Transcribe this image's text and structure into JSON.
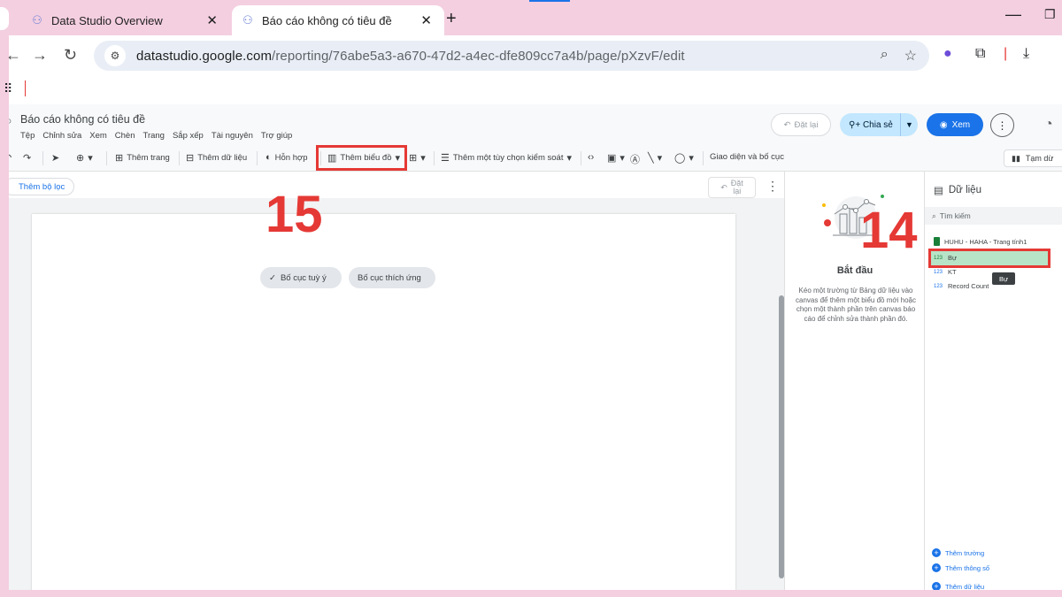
{
  "browser": {
    "tabs": [
      {
        "title": "Data Studio Overview"
      },
      {
        "title": "Báo cáo không có tiêu đề"
      }
    ],
    "new_tab_icon": "+",
    "url_domain": "datastudio.google.com",
    "url_path": "/reporting/76abe5a3-a670-47d2-a4ec-dfe809cc7a4b/page/pXzvF/edit"
  },
  "app": {
    "report_title": "Báo cáo không có tiêu đề",
    "menu": [
      "Tệp",
      "Chỉnh sửa",
      "Xem",
      "Chèn",
      "Trang",
      "Sắp xếp",
      "Tài nguyên",
      "Trợ giúp"
    ],
    "header": {
      "reset_label": "Đặt lại",
      "share_label": "Chia sẻ",
      "view_label": "Xem"
    },
    "toolbar": {
      "add_page": "Thêm trang",
      "add_data": "Thêm dữ liệu",
      "blend": "Hỗn hợp",
      "add_chart": "Thêm biểu đồ",
      "add_control": "Thêm một tùy chọn kiểm soát",
      "theme_layout": "Giao diện và bố cục",
      "pause": "Tạm dừ"
    },
    "filter": {
      "add_filter": "Thêm bộ lọc",
      "reset_line1": "Đặt",
      "reset_line2": "lại"
    },
    "canvas": {
      "layout_free": "Bố cục tuỳ ý",
      "layout_responsive": "Bố cục thích ứng"
    },
    "properties": {
      "title": "Bắt đầu",
      "description": "Kéo một trường từ Bảng dữ liệu vào canvas để thêm một biểu đồ mới hoặc chọn một thành phần trên canvas báo cáo để chỉnh sửa thành phần đó."
    },
    "data_panel": {
      "title": "Dữ liệu",
      "search_placeholder": "Tìm kiếm",
      "source": "HUHU - HAHA - Trang tính1",
      "fields": [
        {
          "type": "123",
          "name": "Bự"
        },
        {
          "type": "123",
          "name": "KT"
        },
        {
          "type": "123",
          "name": "Record Count"
        }
      ],
      "tooltip": "Bự",
      "add_field": "Thêm trường",
      "add_parameter": "Thêm thông số",
      "add_data": "Thêm dữ liệu"
    }
  },
  "annotations": {
    "step_15": "15",
    "step_14": "14"
  },
  "colors": {
    "background": "#f4cfe0",
    "accent": "#1a73e8",
    "annotation": "#e53935",
    "highlight": "#b7e4c7"
  }
}
